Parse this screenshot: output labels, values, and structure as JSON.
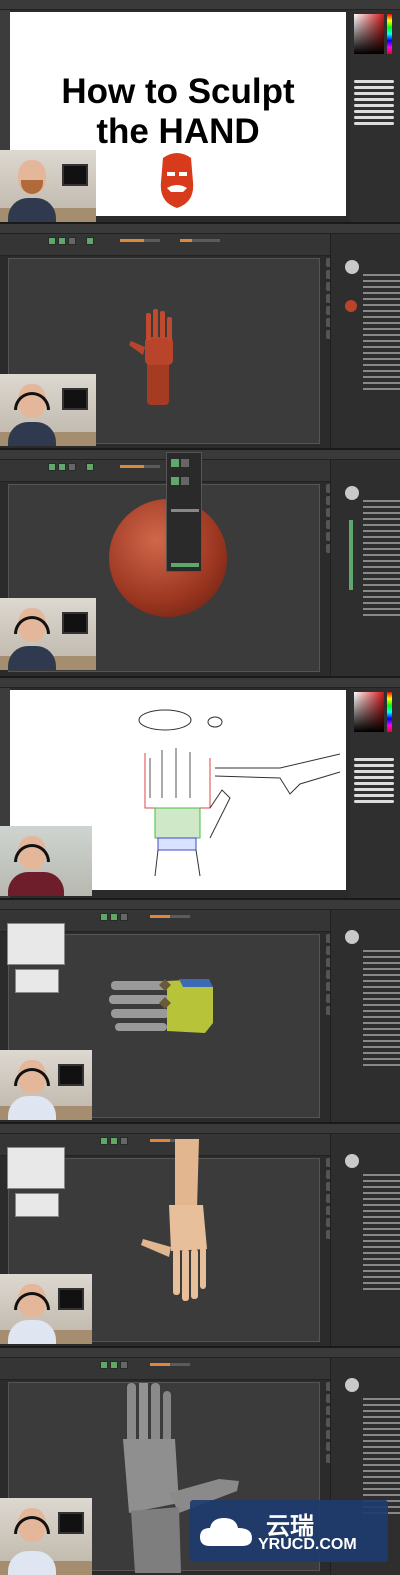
{
  "title": {
    "line1": "How to Sculpt",
    "line2": "the HAND"
  },
  "watermark": {
    "cn": "云瑞",
    "en": "YRUCD.COM"
  },
  "colors": {
    "clay": "#b8452b",
    "skin": "#e2b68f",
    "gray_clay": "#8a8a8a",
    "zbrush_green": "#5fa86b",
    "photoshop_bg": "#2f2f2f",
    "watermark_bg": "#1e3c6e"
  },
  "icons": {
    "logo": "beard-man-logo",
    "watermark": "cloud-icon"
  }
}
